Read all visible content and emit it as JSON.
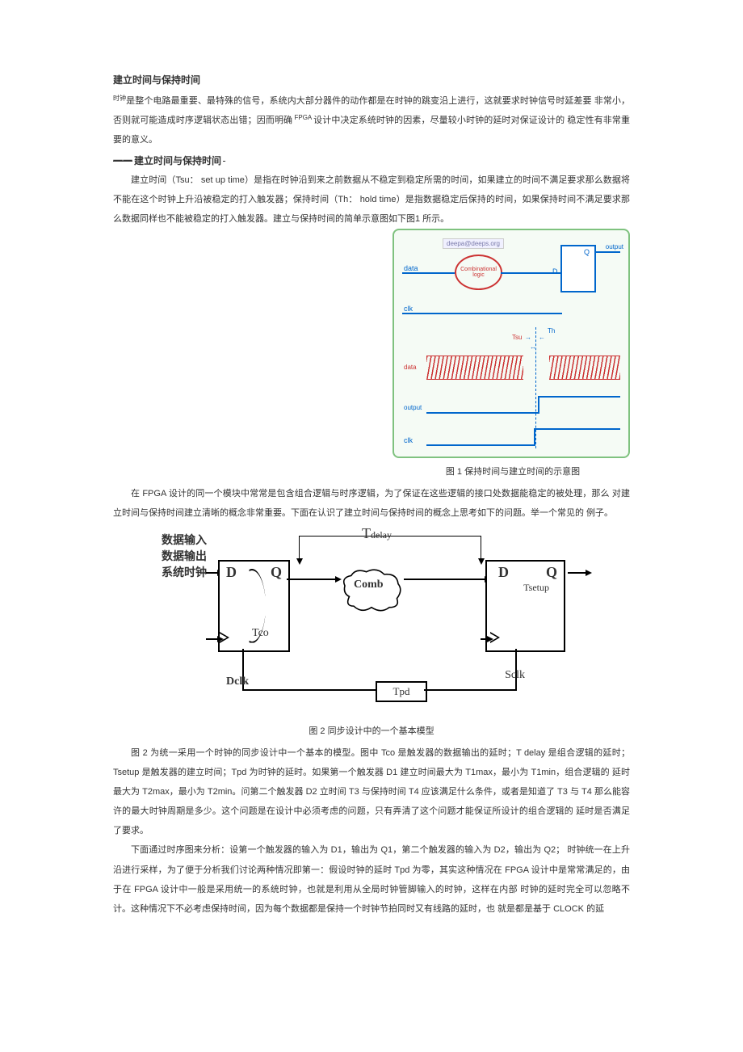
{
  "title": "建立时间与保持时间",
  "p1_a": "时钟",
  "p1_b": "是整个电路最重要、最特殊的信号，系统内大部分器件的动作都是在时钟的跳变沿上进行，这就要求时钟信号时延差要 非常小，否则就可能造成时序逻辑状态出错；因而明确",
  "p1_c": " FPGA ",
  "p1_d": "设计中决定系统时钟的因素，尽量较小时钟的延时对保证设计的 稳定性有非常重要的意义。",
  "sec2_heading_a": "一一",
  "sec2_heading_b": "建立时间与保持时间",
  "p2": "建立时间（Tsu： set up time）是指在时钟沿到来之前数据从不稳定到稳定所需的时间，如果建立的时间不满足要求那么数据将不能在这个时钟上升沿被稳定的打入触发器；保持时间（Th： hold time）是指数据稳定后保持的时间，如果保持时间不满足要求那么数据同样也不能被稳定的打入触发器。建立与保持时间的简单示意图如下图1 所示。",
  "fig1": {
    "email": "deepa@deeps.org",
    "comb": "Combinational logic",
    "data_label": "data",
    "d": "D",
    "q": "Q",
    "output": "output",
    "clk": "clk",
    "tsu": "Tsu",
    "th": "Th",
    "caption": "图 1 保持时间与建立时间的示意图"
  },
  "p3": "在 FPGA 设计的同一个模块中常常是包含组合逻辑与时序逻辑，为了保证在这些逻辑的接口处数据能稳定的被处理，那么 对建立时间与保持时间建立清晰的概念非常重要。下面在认识了建立时间与保持时间的概念上思考如下的问题。举一个常见的 例子。",
  "fig2": {
    "data_in": "数据输入",
    "data_out": "数据输出",
    "sys_clk": "系统时钟",
    "D": "D",
    "Q": "Q",
    "Tco": "Tco",
    "Comb": "Comb",
    "Tdelay": "Tdelay",
    "Tsetup": "Tsetup",
    "Dclk": "Dclk",
    "Sclk": "Sclk",
    "Tpd": "Tpd",
    "caption": "图 2 同步设计中的一个基本模型"
  },
  "p4": "图 2 为统一采用一个时钟的同步设计中一个基本的模型。图中 Tco 是触发器的数据输出的延时；T delay 是组合逻辑的延时；Tsetup 是触发器的建立时间；Tpd 为时钟的延时。如果第一个触发器 D1 建立时间最大为 T1max，最小为 T1min，组合逻辑的 延时最大为 T2max，最小为 T2min。问第二个触发器 D2 立时间 T3 与保持时间 T4 应该满足什么条件，或者是知道了 T3 与 T4 那么能容许的最大时钟周期是多少。这个问题是在设计中必须考虑的问题，只有弄清了这个问题才能保证所设计的组合逻辑的 延时是否满足了要求。",
  "p5": "下面通过时序图来分析：设第一个触发器的输入为 D1，输出为 Q1，第二个触发器的输入为 D2，输出为 Q2； 时钟统一在上升沿进行采样，为了便于分析我们讨论两种情况即第一：假设时钟的延时 Tpd 为零，其实这种情况在 FPGA 设计中是常常满足的，由于在 FPGA 设计中一般是采用统一的系统时钟，也就是利用从全局时钟管脚输入的时钟，这样在内部 时钟的延时完全可以忽略不计。这种情况下不必考虑保持时间，因为每个数据都是保持一个时钟节拍同时又有线路的延时，也 就是都是基于 CLOCK 的延"
}
